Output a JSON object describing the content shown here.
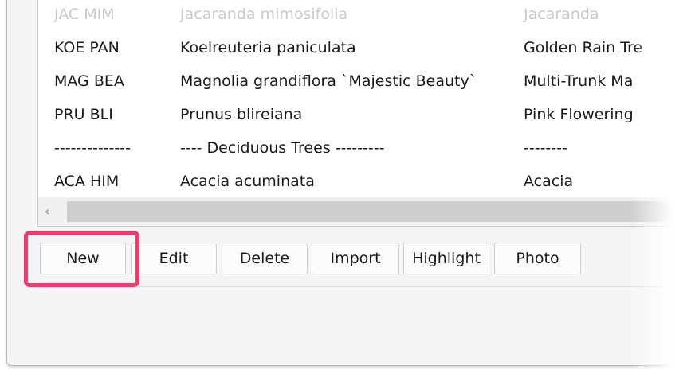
{
  "plant_list": {
    "rows": [
      {
        "code": "JAC MIM",
        "botanical": "Jacaranda mimosifolia",
        "common": "Jacaranda"
      },
      {
        "code": "KOE PAN",
        "botanical": "Koelreuteria paniculata",
        "common": "Golden Rain Tre"
      },
      {
        "code": "MAG BEA",
        "botanical": "Magnolia grandiflora `Majestic Beauty`",
        "common": "Multi-Trunk Ma"
      },
      {
        "code": "PRU BLI",
        "botanical": "Prunus blireiana",
        "common": "Pink Flowering"
      },
      {
        "code": "--------------",
        "botanical": "---- Deciduous Trees ---------",
        "common": "--------"
      },
      {
        "code": "ACA HIM",
        "botanical": "Acacia acuminata",
        "common": "Acacia"
      }
    ],
    "scroll_left_arrow": "‹"
  },
  "buttons": {
    "new": "New",
    "edit": "Edit",
    "delete": "Delete",
    "import": "Import",
    "highlight": "Highlight",
    "photo": "Photo"
  },
  "colors": {
    "callout_highlight": "#ef3c6d",
    "panel_background": "#f5f5f5",
    "list_background": "#ffffff"
  }
}
